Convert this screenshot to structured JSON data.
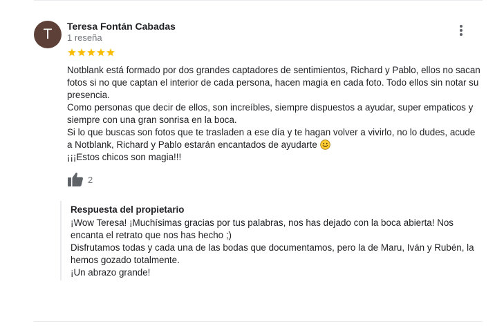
{
  "review": {
    "avatar_letter": "T",
    "avatar_color": "#5d4037",
    "reviewer_name": "Teresa Fontán Cabadas",
    "review_count": "1 reseña",
    "rating": 5,
    "star_color": "#fbbc04",
    "paragraphs": [
      "Notblank está formado por dos grandes captadores de sentimientos, Richard y Pablo, ellos no sacan fotos si no que captan el interior de cada persona, hacen magia en cada foto. Todo ellos sin notar su presencia.",
      "Como personas que decir de ellos, son increíbles, siempre dispuestos a ayudar, super empaticos y siempre con una gran sonrisa en la boca.",
      "Si lo que buscas son fotos que te trasladen a ese día y te hagan volver a vivirlo, no lo dudes, acude a Notblank, Richard y Pablo estarán encantados de ayudarte",
      "¡¡¡Estos chicos son magia!!!"
    ],
    "emoji_icon": "smiling-face-icon",
    "like_icon": "thumbs-up-icon",
    "like_count": "2",
    "menu_icon": "more-vert-icon"
  },
  "owner_response": {
    "title": "Respuesta del propietario",
    "paragraphs": [
      "¡Wow Teresa! ¡Muchísimas gracias por tus palabras, nos has dejado con la boca abierta! Nos encanta el retrato que nos has hecho ;)",
      "Disfrutamos todas y cada una de las bodas que documentamos, pero la de Maru, Iván y Rubén, la hemos gozado totalmente.",
      "¡Un abrazo grande!"
    ]
  }
}
